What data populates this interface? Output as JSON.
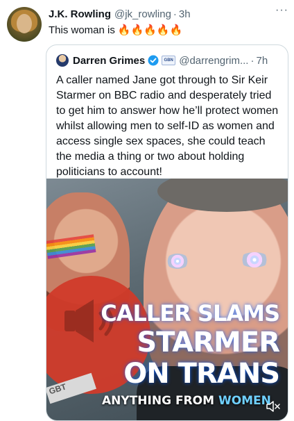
{
  "tweet": {
    "author_name": "J.K. Rowling",
    "author_handle": "@jk_rowling",
    "dot": "·",
    "time": "3h",
    "text": "This woman is",
    "emoji": "🔥🔥🔥🔥🔥",
    "more": "···"
  },
  "quoted": {
    "author_name": "Darren Grimes",
    "badge": "GBN",
    "author_handle": "@darrengrim...",
    "dot": "·",
    "time": "7h",
    "text": "A caller named Jane got through to Sir Keir Starmer on BBC radio and desperately tried to get him to answer how he’ll protect women whilst allowing men to self-ID as women and access single sex spaces, she could teach the media a thing or two about holding politicians to account!"
  },
  "media": {
    "headline_line1": "CALLER SLAMS",
    "headline_line2": "STARMER",
    "headline_line3": "ON TRANS",
    "subtitle_prefix": "ANYTHING FROM ",
    "subtitle_highlight": "WOMEN",
    "sign_text": "GBT",
    "colors": {
      "circle": "#d13b2a",
      "caption_glow": "#005aff",
      "highlight": "#6fd0ff"
    }
  },
  "icons": [
    "avatar",
    "verified-badge-icon",
    "speaker-icon",
    "mute-icon",
    "more-icon"
  ]
}
